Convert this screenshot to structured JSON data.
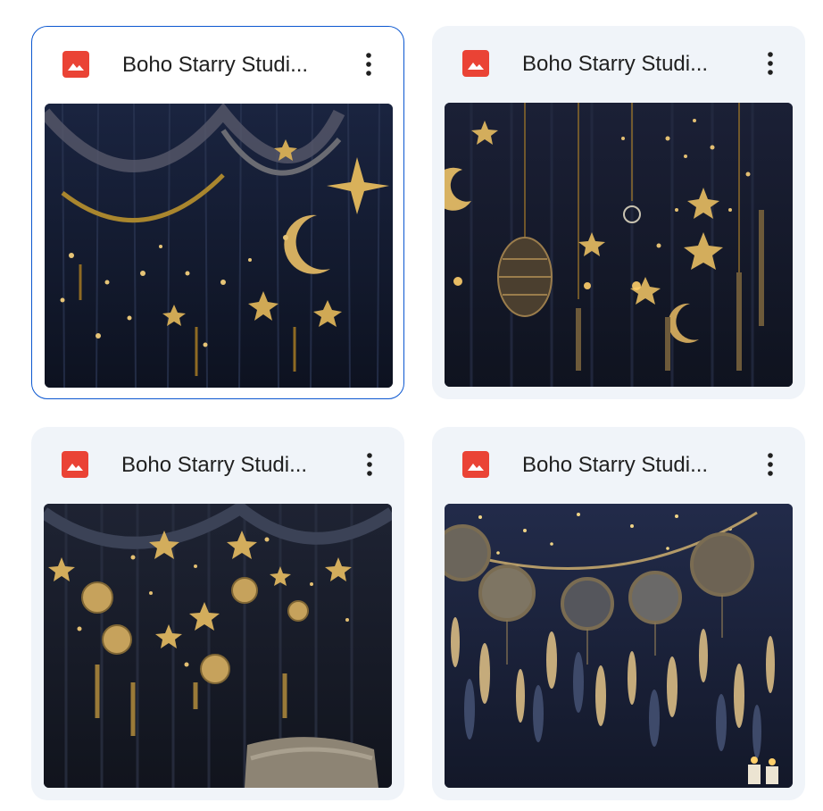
{
  "files": [
    {
      "title": "Boho Starry Studi...",
      "type_icon": "image-file-icon",
      "selected": true
    },
    {
      "title": "Boho Starry Studi...",
      "type_icon": "image-file-icon",
      "selected": false
    },
    {
      "title": "Boho Starry Studi...",
      "type_icon": "image-file-icon",
      "selected": false
    },
    {
      "title": "Boho Starry Studi...",
      "type_icon": "image-file-icon",
      "selected": false
    }
  ],
  "colors": {
    "card_bg": "#f0f4f9",
    "selected_border": "#0b57d0",
    "image_icon": "#ea4335",
    "title_text": "#1f1f1f"
  }
}
